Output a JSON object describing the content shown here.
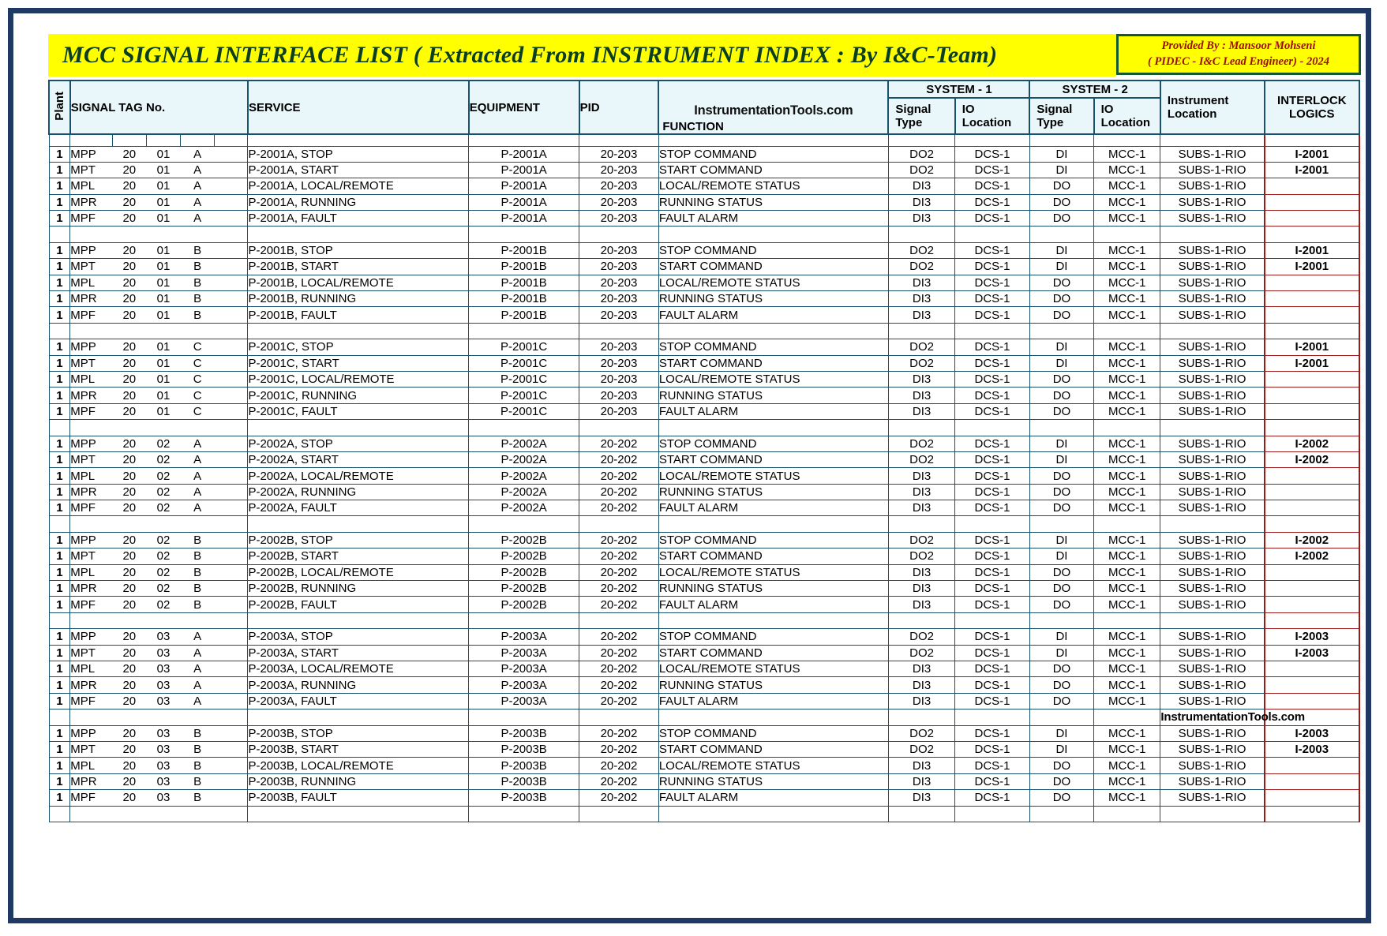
{
  "title": "MCC SIGNAL INTERFACE LIST  ( Extracted From INSTRUMENT INDEX : By I&C-Team)",
  "provided_by": {
    "line1": "Provided By : Mansoor Mohseni",
    "line2": "( PIDEC - I&C Lead Engineer) - 2024"
  },
  "watermark": "InstrumentationTools.com",
  "colors": {
    "title_bg": "#ffff00",
    "title_text": "#0b3d20",
    "provided_text": "#9e0b0f",
    "frame": "#1f3864",
    "header_bg": "#e9f7fb",
    "header_text": "#5b4ddb",
    "plant_bg": "#29b6f6",
    "interlock_border": "#9b1a1a",
    "interlock_text": "#4b3fcf"
  },
  "header": {
    "plant": "Plant",
    "signal_tag": "SIGNAL TAG No.",
    "service": "SERVICE",
    "equipment": "EQUIPMENT",
    "pid": "PID",
    "function": "FUNCTION",
    "system1": "SYSTEM - 1",
    "system2": "SYSTEM - 2",
    "signal_type": "Signal Type",
    "io_location": "IO Location",
    "signal_type_1": "Signal",
    "signal_type_2": "Type",
    "io_location_1": "IO",
    "io_location_2": "Location",
    "instrument_location_1": "Instrument",
    "instrument_location_2": "Location",
    "interlock_1": "INTERLOCK",
    "interlock_2": "LOGICS"
  },
  "rows": [
    {
      "type": "data",
      "plant": "1",
      "t1": "MPP",
      "t2": "20",
      "t3": "01",
      "t4": "A",
      "t5": "",
      "service": "P-2001A, STOP",
      "equipment": "P-2001A",
      "pid": "20-203",
      "function": "STOP COMMAND",
      "s1_type": "DO2",
      "s1_io": "DCS-1",
      "s2_type": "DI",
      "s2_io": "MCC-1",
      "inst_loc": "SUBS-1-RIO",
      "interlock": "I-2001"
    },
    {
      "type": "data",
      "plant": "1",
      "t1": "MPT",
      "t2": "20",
      "t3": "01",
      "t4": "A",
      "t5": "",
      "service": "P-2001A, START",
      "equipment": "P-2001A",
      "pid": "20-203",
      "function": "START COMMAND",
      "s1_type": "DO2",
      "s1_io": "DCS-1",
      "s2_type": "DI",
      "s2_io": "MCC-1",
      "inst_loc": "SUBS-1-RIO",
      "interlock": "I-2001"
    },
    {
      "type": "data",
      "plant": "1",
      "t1": "MPL",
      "t2": "20",
      "t3": "01",
      "t4": "A",
      "t5": "",
      "service": "P-2001A, LOCAL/REMOTE",
      "equipment": "P-2001A",
      "pid": "20-203",
      "function": "LOCAL/REMOTE STATUS",
      "s1_type": "DI3",
      "s1_io": "DCS-1",
      "s2_type": "DO",
      "s2_io": "MCC-1",
      "inst_loc": "SUBS-1-RIO",
      "interlock": ""
    },
    {
      "type": "data",
      "plant": "1",
      "t1": "MPR",
      "t2": "20",
      "t3": "01",
      "t4": "A",
      "t5": "",
      "service": "P-2001A, RUNNING",
      "equipment": "P-2001A",
      "pid": "20-203",
      "function": "RUNNING STATUS",
      "s1_type": "DI3",
      "s1_io": "DCS-1",
      "s2_type": "DO",
      "s2_io": "MCC-1",
      "inst_loc": "SUBS-1-RIO",
      "interlock": ""
    },
    {
      "type": "data",
      "plant": "1",
      "t1": "MPF",
      "t2": "20",
      "t3": "01",
      "t4": "A",
      "t5": "",
      "service": "P-2001A, FAULT",
      "equipment": "P-2001A",
      "pid": "20-203",
      "function": "FAULT ALARM",
      "s1_type": "DI3",
      "s1_io": "DCS-1",
      "s2_type": "DO",
      "s2_io": "MCC-1",
      "inst_loc": "SUBS-1-RIO",
      "interlock": ""
    },
    {
      "type": "gap"
    },
    {
      "type": "data",
      "plant": "1",
      "t1": "MPP",
      "t2": "20",
      "t3": "01",
      "t4": "B",
      "t5": "",
      "service": "P-2001B, STOP",
      "equipment": "P-2001B",
      "pid": "20-203",
      "function": "STOP COMMAND",
      "s1_type": "DO2",
      "s1_io": "DCS-1",
      "s2_type": "DI",
      "s2_io": "MCC-1",
      "inst_loc": "SUBS-1-RIO",
      "interlock": "I-2001"
    },
    {
      "type": "data",
      "plant": "1",
      "t1": "MPT",
      "t2": "20",
      "t3": "01",
      "t4": "B",
      "t5": "",
      "service": "P-2001B, START",
      "equipment": "P-2001B",
      "pid": "20-203",
      "function": "START COMMAND",
      "s1_type": "DO2",
      "s1_io": "DCS-1",
      "s2_type": "DI",
      "s2_io": "MCC-1",
      "inst_loc": "SUBS-1-RIO",
      "interlock": "I-2001"
    },
    {
      "type": "data",
      "plant": "1",
      "t1": "MPL",
      "t2": "20",
      "t3": "01",
      "t4": "B",
      "t5": "",
      "service": "P-2001B, LOCAL/REMOTE",
      "equipment": "P-2001B",
      "pid": "20-203",
      "function": "LOCAL/REMOTE STATUS",
      "s1_type": "DI3",
      "s1_io": "DCS-1",
      "s2_type": "DO",
      "s2_io": "MCC-1",
      "inst_loc": "SUBS-1-RIO",
      "interlock": ""
    },
    {
      "type": "data",
      "plant": "1",
      "t1": "MPR",
      "t2": "20",
      "t3": "01",
      "t4": "B",
      "t5": "",
      "service": "P-2001B, RUNNING",
      "equipment": "P-2001B",
      "pid": "20-203",
      "function": "RUNNING STATUS",
      "s1_type": "DI3",
      "s1_io": "DCS-1",
      "s2_type": "DO",
      "s2_io": "MCC-1",
      "inst_loc": "SUBS-1-RIO",
      "interlock": ""
    },
    {
      "type": "data",
      "plant": "1",
      "t1": "MPF",
      "t2": "20",
      "t3": "01",
      "t4": "B",
      "t5": "",
      "service": "P-2001B, FAULT",
      "equipment": "P-2001B",
      "pid": "20-203",
      "function": "FAULT ALARM",
      "s1_type": "DI3",
      "s1_io": "DCS-1",
      "s2_type": "DO",
      "s2_io": "MCC-1",
      "inst_loc": "SUBS-1-RIO",
      "interlock": ""
    },
    {
      "type": "gap"
    },
    {
      "type": "data",
      "plant": "1",
      "t1": "MPP",
      "t2": "20",
      "t3": "01",
      "t4": "C",
      "t5": "",
      "service": "P-2001C, STOP",
      "equipment": "P-2001C",
      "pid": "20-203",
      "function": "STOP COMMAND",
      "s1_type": "DO2",
      "s1_io": "DCS-1",
      "s2_type": "DI",
      "s2_io": "MCC-1",
      "inst_loc": "SUBS-1-RIO",
      "interlock": "I-2001"
    },
    {
      "type": "data",
      "plant": "1",
      "t1": "MPT",
      "t2": "20",
      "t3": "01",
      "t4": "C",
      "t5": "",
      "service": "P-2001C, START",
      "equipment": "P-2001C",
      "pid": "20-203",
      "function": "START COMMAND",
      "s1_type": "DO2",
      "s1_io": "DCS-1",
      "s2_type": "DI",
      "s2_io": "MCC-1",
      "inst_loc": "SUBS-1-RIO",
      "interlock": "I-2001"
    },
    {
      "type": "data",
      "plant": "1",
      "t1": "MPL",
      "t2": "20",
      "t3": "01",
      "t4": "C",
      "t5": "",
      "service": "P-2001C, LOCAL/REMOTE",
      "equipment": "P-2001C",
      "pid": "20-203",
      "function": "LOCAL/REMOTE STATUS",
      "s1_type": "DI3",
      "s1_io": "DCS-1",
      "s2_type": "DO",
      "s2_io": "MCC-1",
      "inst_loc": "SUBS-1-RIO",
      "interlock": ""
    },
    {
      "type": "data",
      "plant": "1",
      "t1": "MPR",
      "t2": "20",
      "t3": "01",
      "t4": "C",
      "t5": "",
      "service": "P-2001C, RUNNING",
      "equipment": "P-2001C",
      "pid": "20-203",
      "function": "RUNNING STATUS",
      "s1_type": "DI3",
      "s1_io": "DCS-1",
      "s2_type": "DO",
      "s2_io": "MCC-1",
      "inst_loc": "SUBS-1-RIO",
      "interlock": ""
    },
    {
      "type": "data",
      "plant": "1",
      "t1": "MPF",
      "t2": "20",
      "t3": "01",
      "t4": "C",
      "t5": "",
      "service": "P-2001C, FAULT",
      "equipment": "P-2001C",
      "pid": "20-203",
      "function": "FAULT ALARM",
      "s1_type": "DI3",
      "s1_io": "DCS-1",
      "s2_type": "DO",
      "s2_io": "MCC-1",
      "inst_loc": "SUBS-1-RIO",
      "interlock": ""
    },
    {
      "type": "gap"
    },
    {
      "type": "data",
      "plant": "1",
      "t1": "MPP",
      "t2": "20",
      "t3": "02",
      "t4": "A",
      "t5": "",
      "service": "P-2002A, STOP",
      "equipment": "P-2002A",
      "pid": "20-202",
      "function": "STOP COMMAND",
      "s1_type": "DO2",
      "s1_io": "DCS-1",
      "s2_type": "DI",
      "s2_io": "MCC-1",
      "inst_loc": "SUBS-1-RIO",
      "interlock": "I-2002"
    },
    {
      "type": "data",
      "plant": "1",
      "t1": "MPT",
      "t2": "20",
      "t3": "02",
      "t4": "A",
      "t5": "",
      "service": "P-2002A, START",
      "equipment": "P-2002A",
      "pid": "20-202",
      "function": "START COMMAND",
      "s1_type": "DO2",
      "s1_io": "DCS-1",
      "s2_type": "DI",
      "s2_io": "MCC-1",
      "inst_loc": "SUBS-1-RIO",
      "interlock": "I-2002"
    },
    {
      "type": "data",
      "plant": "1",
      "t1": "MPL",
      "t2": "20",
      "t3": "02",
      "t4": "A",
      "t5": "",
      "service": "P-2002A, LOCAL/REMOTE",
      "equipment": "P-2002A",
      "pid": "20-202",
      "function": "LOCAL/REMOTE STATUS",
      "s1_type": "DI3",
      "s1_io": "DCS-1",
      "s2_type": "DO",
      "s2_io": "MCC-1",
      "inst_loc": "SUBS-1-RIO",
      "interlock": ""
    },
    {
      "type": "data",
      "plant": "1",
      "t1": "MPR",
      "t2": "20",
      "t3": "02",
      "t4": "A",
      "t5": "",
      "service": "P-2002A, RUNNING",
      "equipment": "P-2002A",
      "pid": "20-202",
      "function": "RUNNING STATUS",
      "s1_type": "DI3",
      "s1_io": "DCS-1",
      "s2_type": "DO",
      "s2_io": "MCC-1",
      "inst_loc": "SUBS-1-RIO",
      "interlock": ""
    },
    {
      "type": "data",
      "plant": "1",
      "t1": "MPF",
      "t2": "20",
      "t3": "02",
      "t4": "A",
      "t5": "",
      "service": "P-2002A, FAULT",
      "equipment": "P-2002A",
      "pid": "20-202",
      "function": "FAULT ALARM",
      "s1_type": "DI3",
      "s1_io": "DCS-1",
      "s2_type": "DO",
      "s2_io": "MCC-1",
      "inst_loc": "SUBS-1-RIO",
      "interlock": ""
    },
    {
      "type": "gap"
    },
    {
      "type": "data",
      "plant": "1",
      "t1": "MPP",
      "t2": "20",
      "t3": "02",
      "t4": "B",
      "t5": "",
      "service": "P-2002B, STOP",
      "equipment": "P-2002B",
      "pid": "20-202",
      "function": "STOP COMMAND",
      "s1_type": "DO2",
      "s1_io": "DCS-1",
      "s2_type": "DI",
      "s2_io": "MCC-1",
      "inst_loc": "SUBS-1-RIO",
      "interlock": "I-2002"
    },
    {
      "type": "data",
      "plant": "1",
      "t1": "MPT",
      "t2": "20",
      "t3": "02",
      "t4": "B",
      "t5": "",
      "service": "P-2002B, START",
      "equipment": "P-2002B",
      "pid": "20-202",
      "function": "START COMMAND",
      "s1_type": "DO2",
      "s1_io": "DCS-1",
      "s2_type": "DI",
      "s2_io": "MCC-1",
      "inst_loc": "SUBS-1-RIO",
      "interlock": "I-2002"
    },
    {
      "type": "data",
      "plant": "1",
      "t1": "MPL",
      "t2": "20",
      "t3": "02",
      "t4": "B",
      "t5": "",
      "service": "P-2002B, LOCAL/REMOTE",
      "equipment": "P-2002B",
      "pid": "20-202",
      "function": "LOCAL/REMOTE STATUS",
      "s1_type": "DI3",
      "s1_io": "DCS-1",
      "s2_type": "DO",
      "s2_io": "MCC-1",
      "inst_loc": "SUBS-1-RIO",
      "interlock": ""
    },
    {
      "type": "data",
      "plant": "1",
      "t1": "MPR",
      "t2": "20",
      "t3": "02",
      "t4": "B",
      "t5": "",
      "service": "P-2002B, RUNNING",
      "equipment": "P-2002B",
      "pid": "20-202",
      "function": "RUNNING STATUS",
      "s1_type": "DI3",
      "s1_io": "DCS-1",
      "s2_type": "DO",
      "s2_io": "MCC-1",
      "inst_loc": "SUBS-1-RIO",
      "interlock": ""
    },
    {
      "type": "data",
      "plant": "1",
      "t1": "MPF",
      "t2": "20",
      "t3": "02",
      "t4": "B",
      "t5": "",
      "service": "P-2002B, FAULT",
      "equipment": "P-2002B",
      "pid": "20-202",
      "function": "FAULT ALARM",
      "s1_type": "DI3",
      "s1_io": "DCS-1",
      "s2_type": "DO",
      "s2_io": "MCC-1",
      "inst_loc": "SUBS-1-RIO",
      "interlock": ""
    },
    {
      "type": "gap"
    },
    {
      "type": "data",
      "plant": "1",
      "t1": "MPP",
      "t2": "20",
      "t3": "03",
      "t4": "A",
      "t5": "",
      "service": "P-2003A, STOP",
      "equipment": "P-2003A",
      "pid": "20-202",
      "function": "STOP COMMAND",
      "s1_type": "DO2",
      "s1_io": "DCS-1",
      "s2_type": "DI",
      "s2_io": "MCC-1",
      "inst_loc": "SUBS-1-RIO",
      "interlock": "I-2003"
    },
    {
      "type": "data",
      "plant": "1",
      "t1": "MPT",
      "t2": "20",
      "t3": "03",
      "t4": "A",
      "t5": "",
      "service": "P-2003A, START",
      "equipment": "P-2003A",
      "pid": "20-202",
      "function": "START COMMAND",
      "s1_type": "DO2",
      "s1_io": "DCS-1",
      "s2_type": "DI",
      "s2_io": "MCC-1",
      "inst_loc": "SUBS-1-RIO",
      "interlock": "I-2003"
    },
    {
      "type": "data",
      "plant": "1",
      "t1": "MPL",
      "t2": "20",
      "t3": "03",
      "t4": "A",
      "t5": "",
      "service": "P-2003A, LOCAL/REMOTE",
      "equipment": "P-2003A",
      "pid": "20-202",
      "function": "LOCAL/REMOTE STATUS",
      "s1_type": "DI3",
      "s1_io": "DCS-1",
      "s2_type": "DO",
      "s2_io": "MCC-1",
      "inst_loc": "SUBS-1-RIO",
      "interlock": ""
    },
    {
      "type": "data",
      "plant": "1",
      "t1": "MPR",
      "t2": "20",
      "t3": "03",
      "t4": "A",
      "t5": "",
      "service": "P-2003A, RUNNING",
      "equipment": "P-2003A",
      "pid": "20-202",
      "function": "RUNNING STATUS",
      "s1_type": "DI3",
      "s1_io": "DCS-1",
      "s2_type": "DO",
      "s2_io": "MCC-1",
      "inst_loc": "SUBS-1-RIO",
      "interlock": ""
    },
    {
      "type": "data",
      "plant": "1",
      "t1": "MPF",
      "t2": "20",
      "t3": "03",
      "t4": "A",
      "t5": "",
      "service": "P-2003A, FAULT",
      "equipment": "P-2003A",
      "pid": "20-202",
      "function": "FAULT ALARM",
      "s1_type": "DI3",
      "s1_io": "DCS-1",
      "s2_type": "DO",
      "s2_io": "MCC-1",
      "inst_loc": "SUBS-1-RIO",
      "interlock": ""
    },
    {
      "type": "gap",
      "watermark": true
    },
    {
      "type": "data",
      "plant": "1",
      "t1": "MPP",
      "t2": "20",
      "t3": "03",
      "t4": "B",
      "t5": "",
      "service": "P-2003B, STOP",
      "equipment": "P-2003B",
      "pid": "20-202",
      "function": "STOP COMMAND",
      "s1_type": "DO2",
      "s1_io": "DCS-1",
      "s2_type": "DI",
      "s2_io": "MCC-1",
      "inst_loc": "SUBS-1-RIO",
      "interlock": "I-2003"
    },
    {
      "type": "data",
      "plant": "1",
      "t1": "MPT",
      "t2": "20",
      "t3": "03",
      "t4": "B",
      "t5": "",
      "service": "P-2003B, START",
      "equipment": "P-2003B",
      "pid": "20-202",
      "function": "START COMMAND",
      "s1_type": "DO2",
      "s1_io": "DCS-1",
      "s2_type": "DI",
      "s2_io": "MCC-1",
      "inst_loc": "SUBS-1-RIO",
      "interlock": "I-2003"
    },
    {
      "type": "data",
      "plant": "1",
      "t1": "MPL",
      "t2": "20",
      "t3": "03",
      "t4": "B",
      "t5": "",
      "service": "P-2003B, LOCAL/REMOTE",
      "equipment": "P-2003B",
      "pid": "20-202",
      "function": "LOCAL/REMOTE STATUS",
      "s1_type": "DI3",
      "s1_io": "DCS-1",
      "s2_type": "DO",
      "s2_io": "MCC-1",
      "inst_loc": "SUBS-1-RIO",
      "interlock": ""
    },
    {
      "type": "data",
      "plant": "1",
      "t1": "MPR",
      "t2": "20",
      "t3": "03",
      "t4": "B",
      "t5": "",
      "service": "P-2003B, RUNNING",
      "equipment": "P-2003B",
      "pid": "20-202",
      "function": "RUNNING STATUS",
      "s1_type": "DI3",
      "s1_io": "DCS-1",
      "s2_type": "DO",
      "s2_io": "MCC-1",
      "inst_loc": "SUBS-1-RIO",
      "interlock": ""
    },
    {
      "type": "data",
      "plant": "1",
      "t1": "MPF",
      "t2": "20",
      "t3": "03",
      "t4": "B",
      "t5": "",
      "service": "P-2003B, FAULT",
      "equipment": "P-2003B",
      "pid": "20-202",
      "function": "FAULT ALARM",
      "s1_type": "DI3",
      "s1_io": "DCS-1",
      "s2_type": "DO",
      "s2_io": "MCC-1",
      "inst_loc": "SUBS-1-RIO",
      "interlock": ""
    },
    {
      "type": "gap"
    }
  ]
}
